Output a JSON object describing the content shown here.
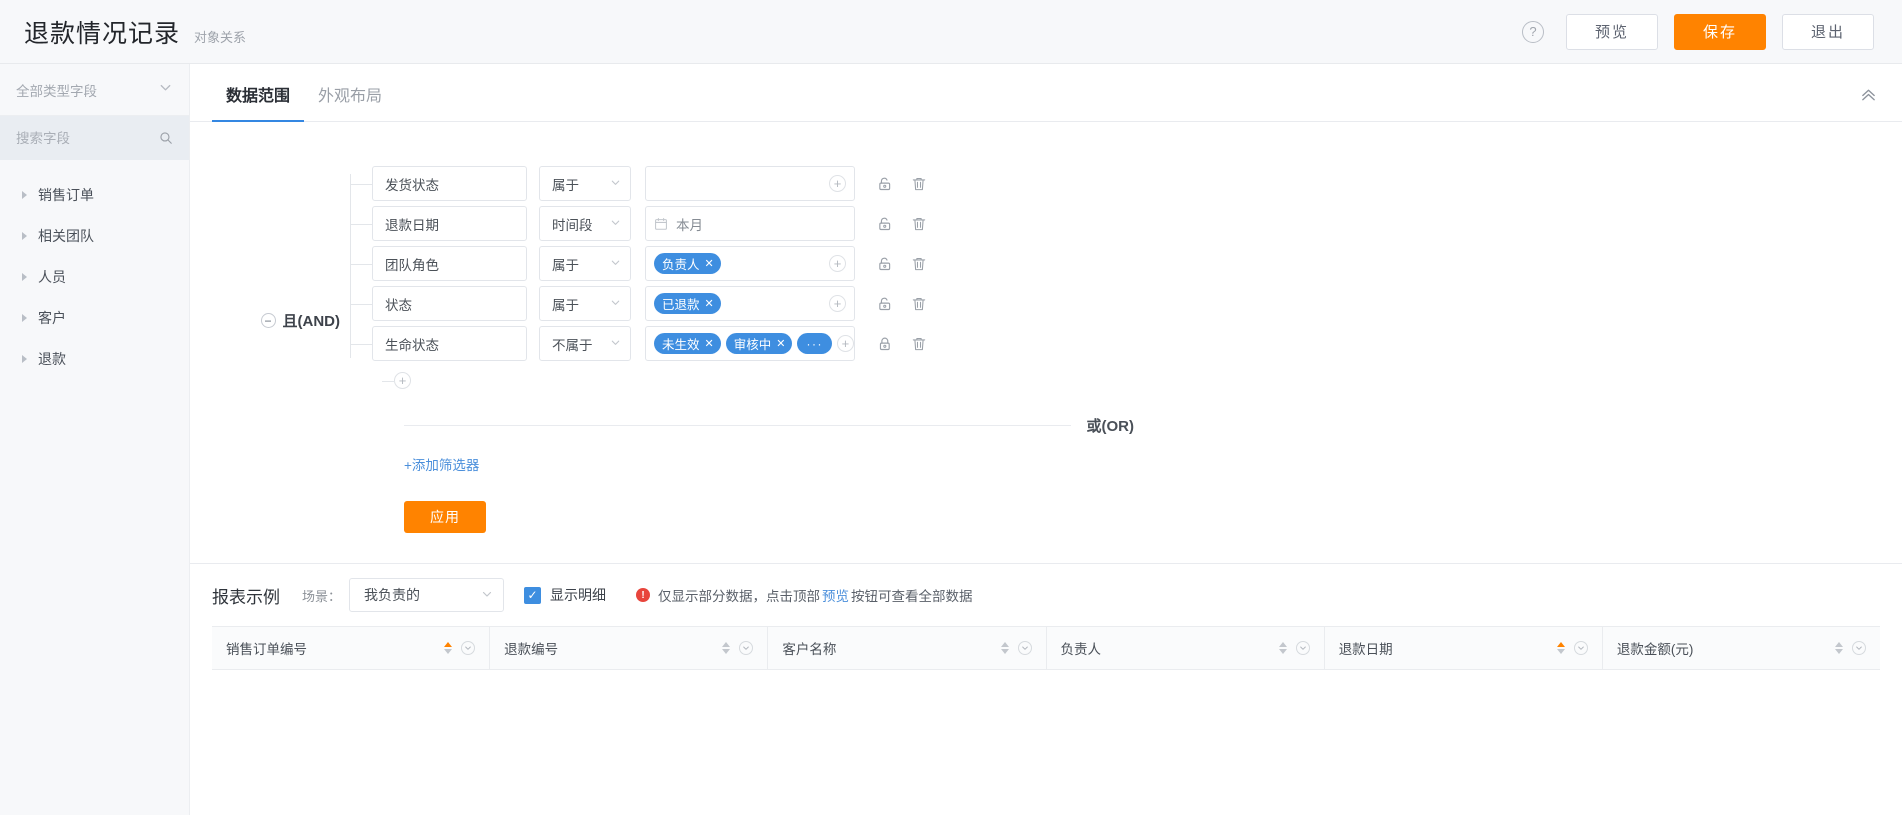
{
  "header": {
    "title": "退款情况记录",
    "subtitle": "对象关系",
    "help_icon": "?",
    "preview_label": "预览",
    "save_label": "保存",
    "exit_label": "退出",
    "accent_orange": "#ff8300"
  },
  "sidebar": {
    "type_filter_label": "全部类型字段",
    "search_placeholder": "搜索字段",
    "search_value": "",
    "items": [
      {
        "label": "销售订单"
      },
      {
        "label": "相关团队"
      },
      {
        "label": "人员"
      },
      {
        "label": "客户"
      },
      {
        "label": "退款"
      }
    ]
  },
  "tabs": [
    {
      "label": "数据范围",
      "active": true
    },
    {
      "label": "外观布局",
      "active": false
    }
  ],
  "filter": {
    "group_operator": "且(AND)",
    "group_toggle": "−",
    "rows": [
      {
        "field": "发货状态",
        "operator": "属于",
        "value_text": "",
        "tags": [],
        "has_add": true,
        "has_date_icon": false
      },
      {
        "field": "退款日期",
        "operator": "时间段",
        "value_text": "本月",
        "tags": [],
        "has_add": false,
        "has_date_icon": true
      },
      {
        "field": "团队角色",
        "operator": "属于",
        "value_text": "",
        "tags": [
          "负责人"
        ],
        "has_add": true,
        "has_date_icon": false
      },
      {
        "field": "状态",
        "operator": "属于",
        "value_text": "",
        "tags": [
          "已退款"
        ],
        "has_add": true,
        "has_date_icon": false
      },
      {
        "field": "生命状态",
        "operator": "不属于",
        "value_text": "",
        "tags": [
          "未生效",
          "审核中",
          "···"
        ],
        "has_add": true,
        "has_date_icon": false
      }
    ],
    "add_condition_label": "+",
    "or_label": "或(OR)",
    "add_filter_label": "+添加筛选器",
    "apply_label": "应用",
    "tag_color": "#3e8ee0"
  },
  "preview": {
    "title": "报表示例",
    "scene_label": "场景：",
    "scene_value": "我负责的",
    "show_detail_checked": true,
    "show_detail_label": "显示明细",
    "warning_prefix": "仅显示部分数据，点击顶部",
    "warning_link": "预览",
    "warning_suffix": "按钮可查看全部数据"
  },
  "table": {
    "columns": [
      {
        "label": "销售订单编号",
        "sort_active": true
      },
      {
        "label": "退款编号",
        "sort_active": false
      },
      {
        "label": "客户名称",
        "sort_active": false
      },
      {
        "label": "负责人",
        "sort_active": false
      },
      {
        "label": "退款日期",
        "sort_active": true
      },
      {
        "label": "退款金额(元)",
        "sort_active": false
      }
    ]
  }
}
